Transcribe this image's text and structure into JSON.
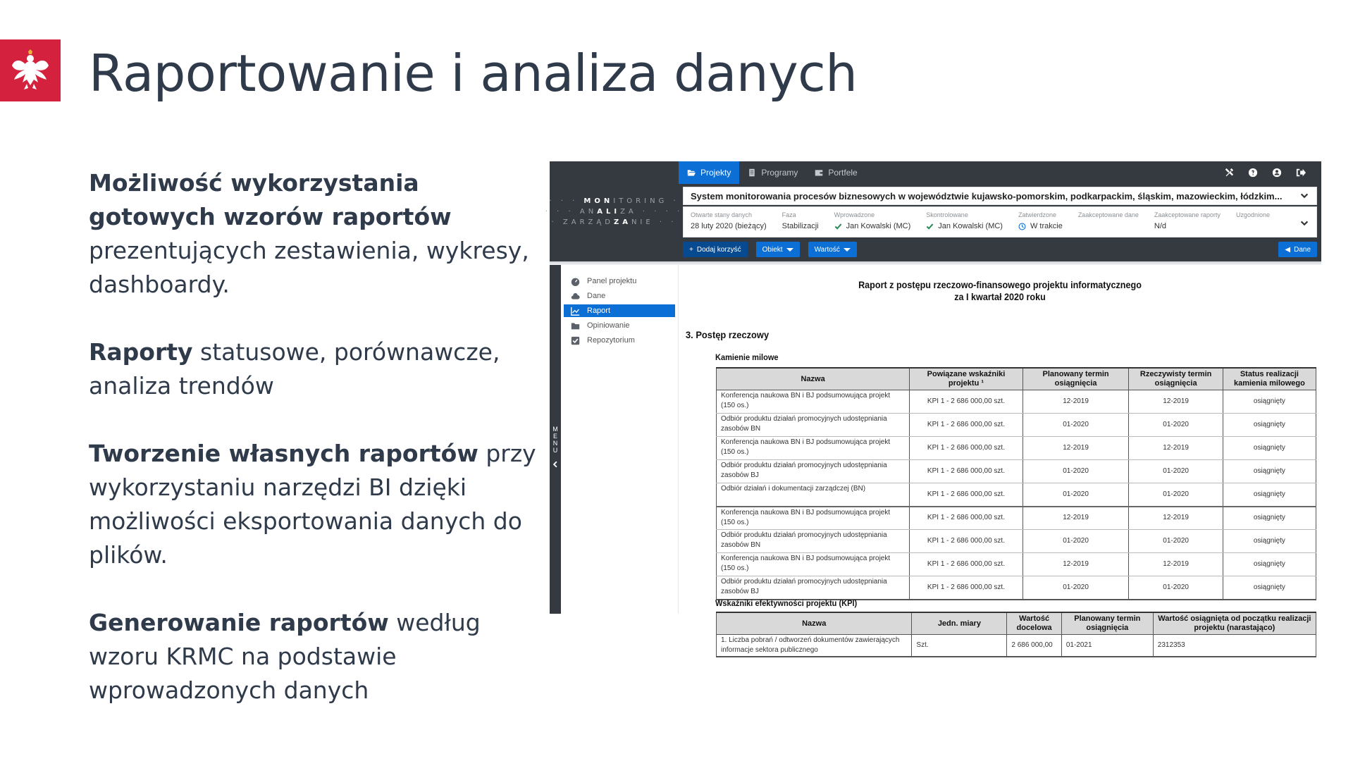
{
  "slide": {
    "title": "Raportowanie i analiza danych",
    "emblem_color": "#d4213d",
    "paragraphs": [
      {
        "bold": "Możliwość wykorzystania gotowych wzorów raportów",
        "rest": " prezentujących zestawienia, wykresy, dashboardy."
      },
      {
        "bold": "Raporty",
        "rest": " statusowe, porównawcze, analiza trendów"
      },
      {
        "bold": "Tworzenie własnych raportów",
        "rest": " przy wykorzystaniu narzędzi BI dzięki możliwości eksportowania danych do plików."
      },
      {
        "bold": "Generowanie raportów",
        "rest": " według wzoru KRMC na podstawie wprowadzonych danych"
      }
    ]
  },
  "app": {
    "brand": {
      "line1_pre": "· · · ",
      "line1_bold": "MON",
      "line1_post": "ITORING ·",
      "line2_pre": "· · · AN",
      "line2_bold": "ALI",
      "line2_post": "ZA · · · ·",
      "line3_pre": "· ZARZĄD",
      "line3_bold": "ZA",
      "line3_post": "NIE · ·"
    },
    "tabs": [
      {
        "label": "Projekty",
        "icon": "folder-open-icon",
        "active": true
      },
      {
        "label": "Programy",
        "icon": "document-icon",
        "active": false
      },
      {
        "label": "Portfele",
        "icon": "wallet-icon",
        "active": false
      }
    ],
    "top_icons": [
      "tools-icon",
      "help-icon",
      "user-icon",
      "logout-icon"
    ],
    "project_title": "System monitorowania procesów biznesowych w województwie kujawsko-pomorskim, podkarpackim, śląskim, mazowieckim, łódzkim...",
    "status_fields": [
      {
        "label": "Otwarte stany danych",
        "value": "28 luty 2020 (bieżący)",
        "icon": null
      },
      {
        "label": "Faza",
        "value": "Stabilizacji",
        "icon": null
      },
      {
        "label": "Wprowadzone",
        "value": "Jan Kowalski (MC)",
        "icon": "check"
      },
      {
        "label": "Skontrolowane",
        "value": "Jan Kowalski (MC)",
        "icon": "check"
      },
      {
        "label": "Zatwierdzone",
        "value": "W trakcie",
        "icon": "clock"
      },
      {
        "label": "Zaakceptowane dane",
        "value": "",
        "icon": null
      },
      {
        "label": "Zaakceptowane raporty",
        "value": "N/d",
        "icon": null
      },
      {
        "label": "Uzgodnione",
        "value": "",
        "icon": null
      }
    ],
    "actions": {
      "add_benefit": "Dodaj korzyść",
      "object": "Obiekt",
      "value": "Wartość",
      "back_data": "Dane"
    },
    "side_menu_label": "MENU",
    "sidebar": [
      {
        "label": "Panel projektu",
        "icon": "dashboard-icon",
        "active": false
      },
      {
        "label": "Dane",
        "icon": "cloud-icon",
        "active": false
      },
      {
        "label": "Raport",
        "icon": "chart-line-icon",
        "active": true
      },
      {
        "label": "Opiniowanie",
        "icon": "folder-icon",
        "active": false
      },
      {
        "label": "Repozytorium",
        "icon": "checkbox-icon",
        "active": false
      }
    ],
    "colors": {
      "accent": "#0b6fd6",
      "dark": "#343a40",
      "accent_dark": "#084a8f",
      "check": "#2e8b57"
    }
  },
  "report": {
    "title_line1": "Raport z postępu rzeczowo-finansowego projektu informatycznego",
    "title_line2": "za I kwartał 2020 roku",
    "section": "3.  Postęp rzeczowy",
    "milestones_heading": "Kamienie milowe",
    "milestones": {
      "headers": [
        "Nazwa",
        "Powiązane wskaźniki projektu ¹",
        "Planowany termin osiągnięcia",
        "Rzeczywisty termin osiągnięcia",
        "Status realizacji kamienia milowego"
      ],
      "rows": [
        [
          "Konferencja naukowa BN i BJ podsumowująca projekt (150 os.)",
          "KPI 1 - 2 686 000,00 szt.",
          "12-2019",
          "12-2019",
          "osiągnięty"
        ],
        [
          "Odbiór produktu działań promocyjnych udostępniania zasobów BN",
          "KPI 1 - 2 686 000,00 szt.",
          "01-2020",
          "01-2020",
          "osiągnięty"
        ],
        [
          "Konferencja naukowa BN i BJ podsumowująca projekt (150 os.)",
          "KPI 1 - 2 686 000,00 szt.",
          "12-2019",
          "12-2019",
          "osiągnięty"
        ],
        [
          "Odbiór produktu działań promocyjnych udostępniania zasobów BJ",
          "KPI 1 - 2 686 000,00 szt.",
          "01-2020",
          "01-2020",
          "osiągnięty"
        ],
        [
          "Odbiór działań i dokumentacji zarządczej (BN)",
          "KPI 1 - 2 686 000,00 szt.",
          "01-2020",
          "01-2020",
          "osiągnięty"
        ],
        [
          "Konferencja naukowa BN i BJ podsumowująca projekt (150 os.)",
          "KPI 1 - 2 686 000,00 szt.",
          "12-2019",
          "12-2019",
          "osiągnięty"
        ],
        [
          "Odbiór produktu działań promocyjnych udostępniania zasobów BN",
          "KPI 1 - 2 686 000,00 szt.",
          "01-2020",
          "01-2020",
          "osiągnięty"
        ],
        [
          "Konferencja naukowa BN i BJ podsumowująca projekt (150 os.)",
          "KPI 1 - 2 686 000,00 szt.",
          "12-2019",
          "12-2019",
          "osiągnięty"
        ],
        [
          "Odbiór produktu działań promocyjnych udostępniania zasobów BJ",
          "KPI 1 - 2 686 000,00 szt.",
          "01-2020",
          "01-2020",
          "osiągnięty"
        ]
      ]
    },
    "kpi_heading": "Wskaźniki efektywności projektu (KPI)",
    "kpi": {
      "headers": [
        "Nazwa",
        "Jedn. miary",
        "Wartość docelowa",
        "Planowany termin osiągnięcia",
        "Wartość osiągnięta od początku realizacji projektu (narastająco)"
      ],
      "rows": [
        [
          "1. Liczba pobrań / odtworzeń dokumentów zawierających informacje sektora publicznego",
          "Szt.",
          "2 686 000,00",
          "01-2021",
          "2312353"
        ]
      ]
    }
  }
}
